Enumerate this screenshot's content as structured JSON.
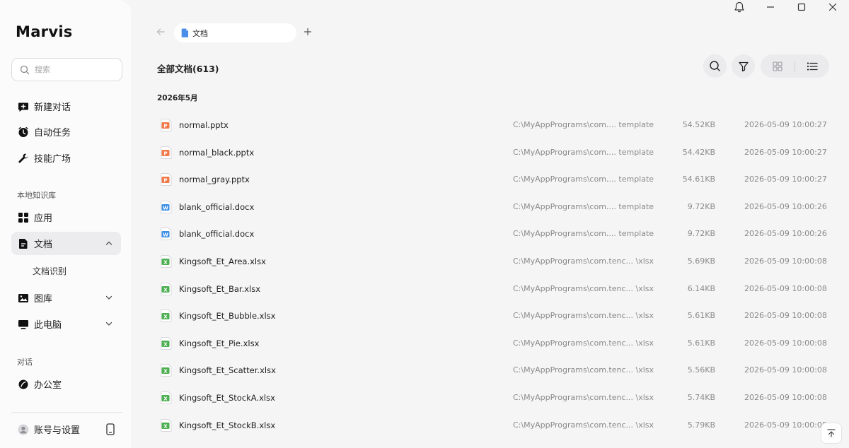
{
  "app": {
    "name": "Marvis"
  },
  "search": {
    "placeholder": "搜索"
  },
  "nav": {
    "new_chat": "新建对话",
    "auto_tasks": "自动任务",
    "skills": "技能广场"
  },
  "local_kb": {
    "label": "本地知识库",
    "apps": "应用",
    "docs": "文档",
    "doc_recognition": "文档识别",
    "gallery": "图库",
    "this_pc": "此电脑"
  },
  "chats": {
    "label": "对话",
    "office": "办公室"
  },
  "account": {
    "label": "账号与设置"
  },
  "tab": {
    "label": "文档"
  },
  "header": {
    "title": "全部文档(613)"
  },
  "group": {
    "label": "2026年5月"
  },
  "files": [
    {
      "name": "normal.pptx",
      "type": "ppt",
      "path": "C:\\MyAppPrograms\\com.... template",
      "size": "54.52KB",
      "date": "2026-05-09 10:00:27"
    },
    {
      "name": "normal_black.pptx",
      "type": "ppt",
      "path": "C:\\MyAppPrograms\\com.... template",
      "size": "54.42KB",
      "date": "2026-05-09 10:00:27"
    },
    {
      "name": "normal_gray.pptx",
      "type": "ppt",
      "path": "C:\\MyAppPrograms\\com.... template",
      "size": "54.61KB",
      "date": "2026-05-09 10:00:27"
    },
    {
      "name": "blank_official.docx",
      "type": "doc",
      "path": "C:\\MyAppPrograms\\com.... template",
      "size": "9.72KB",
      "date": "2026-05-09 10:00:26"
    },
    {
      "name": "blank_official.docx",
      "type": "doc",
      "path": "C:\\MyAppPrograms\\com.... template",
      "size": "9.72KB",
      "date": "2026-05-09 10:00:26"
    },
    {
      "name": "Kingsoft_Et_Area.xlsx",
      "type": "xls",
      "path": "C:\\MyAppPrograms\\com.tenc... \\xlsx",
      "size": "5.69KB",
      "date": "2026-05-09 10:00:08"
    },
    {
      "name": "Kingsoft_Et_Bar.xlsx",
      "type": "xls",
      "path": "C:\\MyAppPrograms\\com.tenc... \\xlsx",
      "size": "6.14KB",
      "date": "2026-05-09 10:00:08"
    },
    {
      "name": "Kingsoft_Et_Bubble.xlsx",
      "type": "xls",
      "path": "C:\\MyAppPrograms\\com.tenc... \\xlsx",
      "size": "5.61KB",
      "date": "2026-05-09 10:00:08"
    },
    {
      "name": "Kingsoft_Et_Pie.xlsx",
      "type": "xls",
      "path": "C:\\MyAppPrograms\\com.tenc... \\xlsx",
      "size": "5.61KB",
      "date": "2026-05-09 10:00:08"
    },
    {
      "name": "Kingsoft_Et_Scatter.xlsx",
      "type": "xls",
      "path": "C:\\MyAppPrograms\\com.tenc... \\xlsx",
      "size": "5.56KB",
      "date": "2026-05-09 10:00:08"
    },
    {
      "name": "Kingsoft_Et_StockA.xlsx",
      "type": "xls",
      "path": "C:\\MyAppPrograms\\com.tenc... \\xlsx",
      "size": "5.74KB",
      "date": "2026-05-09 10:00:08"
    },
    {
      "name": "Kingsoft_Et_StockB.xlsx",
      "type": "xls",
      "path": "C:\\MyAppPrograms\\com.tenc... \\xlsx",
      "size": "5.79KB",
      "date": "2026-05-09 10:00:08"
    }
  ],
  "colors": {
    "ppt": "#f07a4a",
    "doc": "#3b8fe6",
    "xls": "#4caf50"
  },
  "icons": {
    "search": "search-icon",
    "new_chat": "chat-plus-icon",
    "auto_tasks": "clock-icon",
    "skills": "wrench-icon",
    "apps": "grid-icon",
    "docs": "document-icon",
    "gallery": "image-icon",
    "this_pc": "monitor-icon",
    "office": "leaf-icon",
    "account": "user-icon",
    "phone": "phone-icon",
    "bell": "bell-icon",
    "minimize": "minimize-icon",
    "maximize": "maximize-icon",
    "close": "close-icon",
    "back": "arrow-left-icon",
    "add": "plus-icon",
    "filter": "filter-icon",
    "grid_view": "grid-view-icon",
    "list_view": "list-view-icon",
    "scroll_top": "scroll-top-icon"
  }
}
